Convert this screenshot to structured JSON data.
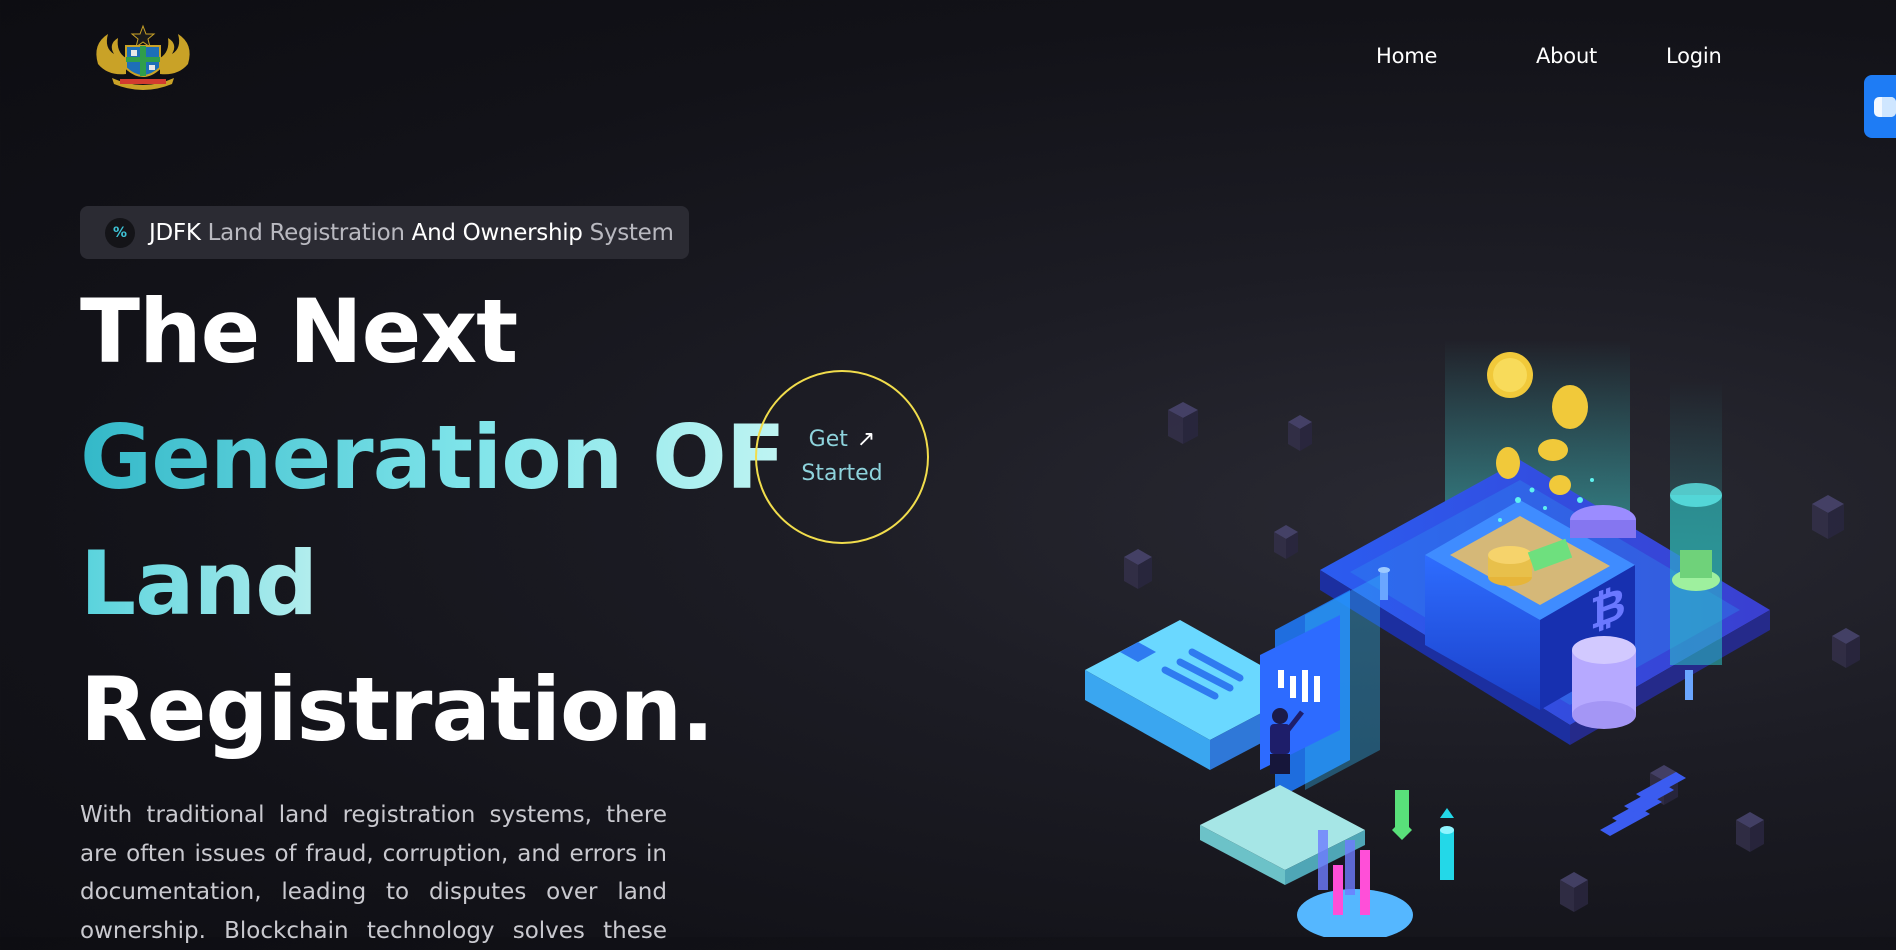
{
  "nav": {
    "home": "Home",
    "about": "About",
    "login": "Login"
  },
  "badge": {
    "part1": "JDFK",
    "part2": "Land Registration",
    "part3": "And Ownership",
    "part4": "System"
  },
  "hero": {
    "line1": "The Next",
    "line2": "Generation OF",
    "line3": "Land",
    "line4": "Registration."
  },
  "description": "With traditional land registration systems, there are often issues of fraud, corruption, and errors in documentation, leading to disputes over land ownership. Blockchain technology solves these",
  "cta": {
    "line1": "Get",
    "line2": "Started",
    "icon": "arrow-up-right-icon"
  },
  "colors": {
    "accent_teal": "#3ec3d6",
    "cta_border": "#f1dd4c",
    "side_tab": "#1e7cf5"
  }
}
